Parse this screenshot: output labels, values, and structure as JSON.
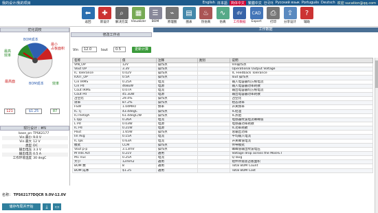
{
  "topbar": {
    "left": "我的设计/我的项目",
    "languages": [
      "English",
      "日本語",
      "简体中文",
      "繁體中文",
      "한국어",
      "Русский язык",
      "Português",
      "Deutsch"
    ],
    "highlighted_index": 2,
    "welcome": "欢迎 sucation@qq.com"
  },
  "toolbar": [
    {
      "label": "返回",
      "icon": "back-arrow-icon",
      "color": "#2a6fb0",
      "glyph": "⬅"
    },
    {
      "label": "新设计",
      "icon": "new-design-icon",
      "color": "#c33",
      "glyph": "✚"
    },
    {
      "label": "解决方案",
      "icon": "solution-search-icon",
      "color": "#666",
      "glyph": "⌕"
    },
    {
      "label": "Visualizer",
      "icon": "visualizer-icon",
      "color": "#7a5",
      "glyph": "▦"
    },
    {
      "label": "BOM",
      "icon": "bom-list-icon",
      "color": "#889",
      "glyph": "☰"
    },
    {
      "label": "原理图",
      "icon": "schematic-icon",
      "color": "#777",
      "glyph": "⌁"
    },
    {
      "label": "图表",
      "icon": "chart-icon",
      "color": "#48a",
      "glyph": "▤"
    },
    {
      "label": "热仿真",
      "icon": "thermal-sim-icon",
      "color": "#a55",
      "glyph": "♨"
    },
    {
      "label": "仿真",
      "icon": "simulation-icon",
      "color": "#5a8",
      "glyph": "∿"
    },
    {
      "label": "工作数据",
      "icon": "work-data-icon",
      "color": "#3864a8",
      "glyph": "dV"
    },
    {
      "label": "Export",
      "icon": "export-cad-icon",
      "color": "#4476b8",
      "glyph": "CAD"
    },
    {
      "label": "打印",
      "icon": "print-icon",
      "color": "#777",
      "glyph": "⎙"
    },
    {
      "label": "分享设计",
      "icon": "share-design-icon",
      "color": "#5a8ac0",
      "glyph": "⇪"
    },
    {
      "label": "辅助",
      "icon": "help-icon",
      "color": "#c33",
      "glyph": "?"
    }
  ],
  "left": {
    "optimize_title": "优化调校",
    "gauge_labels": {
      "efficiency": "最高效率",
      "bom_cost": "BOM成本",
      "footprint": "最小占板面积"
    },
    "power_label": "最高效率(mW)",
    "cost_label": "BOM成本",
    "eff_label": "效率",
    "footprint_value": "121",
    "cost_value": "$1.25",
    "eff_value": "87",
    "current_project_title": "现行设计 : #N",
    "params": [
      {
        "k": "base_pn",
        "v": "TPS62177"
      },
      {
        "k": "Vin 最小",
        "v": "9.0 V"
      },
      {
        "k": "Vin 最大",
        "v": "12 V"
      },
      {
        "k": "类型",
        "v": "DC"
      },
      {
        "k": "输出电压",
        "v": "3.3 V"
      },
      {
        "k": "输出电流",
        "v": "0.5 A"
      },
      {
        "k": "工作环境温度",
        "v": "30 degC"
      }
    ],
    "name_label": "名称：",
    "name_value": "TPS62177DQCR 9.0V-12.0V",
    "save_button": "储存布局并开始"
  },
  "modify": {
    "title": "修改工作点",
    "vin_label": "Vin",
    "vin_value": "12.0",
    "iout_label": "Iout",
    "iout_value": "0.5",
    "update_button": "更新计算"
  },
  "table": {
    "title": "工作数据",
    "headers": [
      "名称",
      "值",
      "注释",
      "类别",
      "说明"
    ],
    "rows": [
      [
        "VIN_OP",
        "12V",
        "操作点",
        "",
        "Vin操作点"
      ],
      [
        "Vout OP",
        "3.3V",
        "操作点",
        "",
        "Operational Output Voltage"
      ],
      [
        "IC Tolerance",
        "0.02V",
        "操作点",
        "",
        "IC Feedback Tolerance"
      ],
      [
        "IOUT_OP",
        "0.5A",
        "操作点",
        "",
        "Iout 操作点"
      ],
      [
        "Cin IRMS",
        "0.25A",
        "电流",
        "",
        "输入电容器均方根电流"
      ],
      [
        "Cin Pd",
        "468uW",
        "电源",
        "",
        "输入电容器功率耗散"
      ],
      [
        "Cout IRMS",
        "0.07A",
        "电流",
        "",
        "输出电容器均方根电流"
      ],
      [
        "Cout Pd",
        "45.3uW",
        "电源",
        "",
        "输出电容器功率耗散"
      ],
      [
        "占空比",
        "29.4%",
        "操作点",
        "",
        "占空比"
      ],
      [
        "效率",
        "87.2%",
        "操作点",
        "",
        "稳态效率"
      ],
      [
        "FSW",
        "1.04MHz",
        "频率",
        "",
        "开关频率"
      ],
      [
        "IC Tj",
        "43.4degC",
        "操作点",
        "",
        "IC结温"
      ],
      [
        "ICThetaJA",
        "61.4degC/W",
        "操作点",
        "",
        "IC热阻"
      ],
      [
        "L Ipp",
        "0.26A",
        "电流",
        "",
        "电感器纹波电流峰峰值"
      ],
      [
        "L Pd",
        "0.03W",
        "电源",
        "",
        "电感器功率耗散"
      ],
      [
        "IC Pd",
        "0.21W",
        "电源",
        "",
        "IC功率耗散"
      ],
      [
        "Pout",
        "1.65W",
        "操作点",
        "",
        "总输出功率"
      ],
      [
        "Iin Avg",
        "0.15A",
        "电流",
        "",
        "平均输入电流"
      ],
      [
        "IC Ipk",
        "0.63A",
        "电流",
        "",
        "开关峰值电流"
      ],
      [
        "模式",
        "CCM",
        "操作点",
        "",
        "传导模式"
      ],
      [
        "Vout p-p",
        "3.13mV",
        "操作点",
        "",
        "峰峰值输出纹波电压"
      ],
      [
        "M Vds Act",
        "0.21V",
        "通用",
        "",
        "Voltage drop across the MosFET"
      ],
      [
        "M1 Iruc",
        "0.25A",
        "电流",
        "",
        "Q Iavg"
      ],
      [
        "大小",
        "12mm2",
        "通用",
        "",
        "组件所需总占板面积"
      ],
      [
        "BOM 数",
        "8",
        "通用",
        "",
        "Total BOM Count"
      ],
      [
        "BOM 成本",
        "$1.25",
        "通用",
        "",
        "Total BOM Cost"
      ]
    ]
  }
}
